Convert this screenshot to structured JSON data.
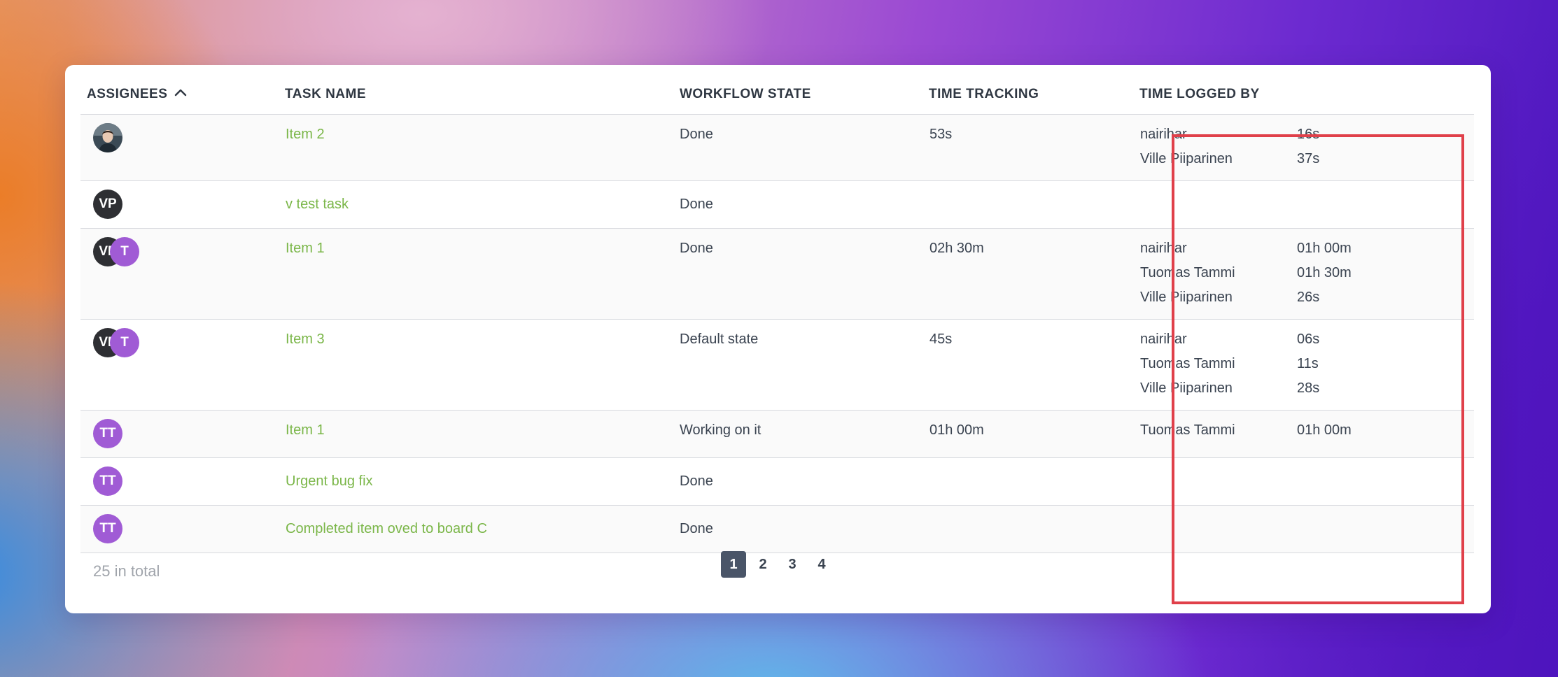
{
  "table": {
    "headers": {
      "assignees": "ASSIGNEES",
      "task_name": "TASK NAME",
      "workflow_state": "WORKFLOW STATE",
      "time_tracking": "TIME TRACKING",
      "time_logged_by": "TIME LOGGED BY"
    },
    "sort": {
      "column": "assignees",
      "direction": "ascending",
      "icon": "chevron-up-icon"
    },
    "rows": [
      {
        "avatars": [
          {
            "type": "photo",
            "initials": ""
          }
        ],
        "task": "Item 2",
        "state": "Done",
        "tracking": "53s",
        "logged": [
          {
            "name": "nairihar",
            "time": "16s"
          },
          {
            "name": "Ville Piiparinen",
            "time": "37s"
          }
        ]
      },
      {
        "avatars": [
          {
            "type": "dark",
            "initials": "VP"
          }
        ],
        "task": "v test task",
        "state": "Done",
        "tracking": "",
        "logged": []
      },
      {
        "avatars": [
          {
            "type": "dark",
            "initials": "VP"
          },
          {
            "type": "purple",
            "initials": "T"
          }
        ],
        "task": "Item 1",
        "state": "Done",
        "tracking": "02h 30m",
        "logged": [
          {
            "name": "nairihar",
            "time": "01h 00m"
          },
          {
            "name": "Tuomas Tammi",
            "time": "01h 30m"
          },
          {
            "name": "Ville Piiparinen",
            "time": "26s"
          }
        ]
      },
      {
        "avatars": [
          {
            "type": "dark",
            "initials": "VP"
          },
          {
            "type": "purple",
            "initials": "T"
          }
        ],
        "task": "Item 3",
        "state": "Default state",
        "tracking": "45s",
        "logged": [
          {
            "name": "nairihar",
            "time": "06s"
          },
          {
            "name": "Tuomas Tammi",
            "time": "11s"
          },
          {
            "name": "Ville Piiparinen",
            "time": "28s"
          }
        ]
      },
      {
        "avatars": [
          {
            "type": "purple",
            "initials": "TT"
          }
        ],
        "task": "Item 1",
        "state": "Working on it",
        "tracking": "01h 00m",
        "logged": [
          {
            "name": "Tuomas Tammi",
            "time": "01h 00m"
          }
        ]
      },
      {
        "avatars": [
          {
            "type": "purple",
            "initials": "TT"
          }
        ],
        "task": "Urgent bug fix",
        "state": "Done",
        "tracking": "",
        "logged": []
      },
      {
        "avatars": [
          {
            "type": "purple",
            "initials": "TT"
          }
        ],
        "task": "Completed item oved to board C",
        "state": "Done",
        "tracking": "",
        "logged": []
      }
    ]
  },
  "footer": {
    "total": "25 in total",
    "pages": [
      "1",
      "2",
      "3",
      "4"
    ],
    "current_page": "1"
  },
  "colors": {
    "task_link": "#7ab648",
    "avatar_dark": "#2e2f33",
    "avatar_purple": "#a05bd5",
    "highlight_border": "#e0404a",
    "active_page": "#4a5568"
  }
}
